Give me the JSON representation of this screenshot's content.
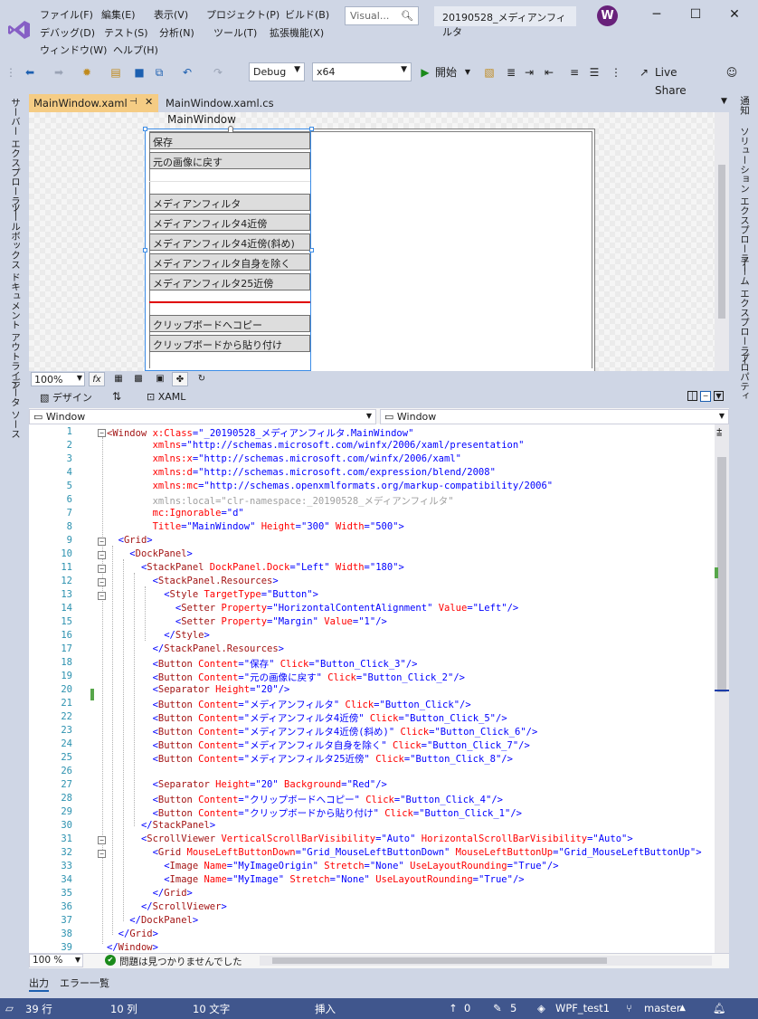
{
  "menu": {
    "row1": [
      "ファイル(F)",
      "編集(E)",
      "表示(V)",
      "プロジェクト(P)",
      "ビルド(B)"
    ],
    "row2": [
      "デバッグ(D)",
      "テスト(S)",
      "分析(N)",
      "ツール(T)",
      "拡張機能(X)"
    ],
    "row3": [
      "ウィンドウ(W)",
      "ヘルプ(H)"
    ],
    "search_placeholder": "Visual...",
    "project_title": "20190528_メディアンフィルタ",
    "avatar_letter": "W"
  },
  "toolbar": {
    "config": "Debug",
    "platform": "x64",
    "start": "開始",
    "liveshare": "Live Share"
  },
  "left_panels": [
    "サーバー エクスプローラー",
    "ツールボックス",
    "ドキュメント アウトライン",
    "データ ソース"
  ],
  "right_panels": [
    "通知",
    "ソリューション エクスプローラー",
    "チーム エクスプローラー",
    "プロパティ"
  ],
  "tabs": [
    {
      "label": "MainWindow.xaml",
      "active": true
    },
    {
      "label": "MainWindow.xaml.cs",
      "active": false
    }
  ],
  "design": {
    "window_title": "MainWindow",
    "buttons_top": [
      "保存",
      "元の画像に戻す"
    ],
    "buttons_mid": [
      "メディアンフィルタ",
      "メディアンフィルタ4近傍",
      "メディアンフィルタ4近傍(斜め)",
      "メディアンフィルタ自身を除く",
      "メディアンフィルタ25近傍"
    ],
    "buttons_bottom": [
      "クリップボードへコピー",
      "クリップボードから貼り付け"
    ],
    "zoom": "100%"
  },
  "split": {
    "design_tab": "デザイン",
    "xaml_tab": "XAML"
  },
  "element_combos": {
    "left": "Window",
    "right": "Window"
  },
  "code_lines": [
    [
      [
        "tg",
        "<"
      ],
      [
        "tg",
        "Window"
      ],
      [
        "at",
        " x:Class"
      ],
      [
        "br",
        "=\""
      ],
      [
        "vl",
        "_20190528_メディアンフィルタ.MainWindow"
      ],
      [
        "br",
        "\""
      ]
    ],
    [
      [
        "pad",
        "        "
      ],
      [
        "at",
        "xmlns"
      ],
      [
        "br",
        "=\""
      ],
      [
        "vl",
        "http://schemas.microsoft.com/winfx/2006/xaml/presentation"
      ],
      [
        "br",
        "\""
      ]
    ],
    [
      [
        "pad",
        "        "
      ],
      [
        "at",
        "xmlns:x"
      ],
      [
        "br",
        "=\""
      ],
      [
        "vl",
        "http://schemas.microsoft.com/winfx/2006/xaml"
      ],
      [
        "br",
        "\""
      ]
    ],
    [
      [
        "pad",
        "        "
      ],
      [
        "at",
        "xmlns:d"
      ],
      [
        "br",
        "=\""
      ],
      [
        "vl",
        "http://schemas.microsoft.com/expression/blend/2008"
      ],
      [
        "br",
        "\""
      ]
    ],
    [
      [
        "pad",
        "        "
      ],
      [
        "at",
        "xmlns:mc"
      ],
      [
        "br",
        "=\""
      ],
      [
        "vl",
        "http://schemas.openxmlformats.org/markup-compatibility/2006"
      ],
      [
        "br",
        "\""
      ]
    ],
    [
      [
        "pad",
        "        "
      ],
      [
        "gr",
        "xmlns:local=\"clr-namespace:_20190528_メディアンフィルタ\""
      ]
    ],
    [
      [
        "pad",
        "        "
      ],
      [
        "at",
        "mc:Ignorable"
      ],
      [
        "br",
        "=\""
      ],
      [
        "vl",
        "d"
      ],
      [
        "br",
        "\""
      ]
    ],
    [
      [
        "pad",
        "        "
      ],
      [
        "at",
        "Title"
      ],
      [
        "br",
        "=\""
      ],
      [
        "vl",
        "MainWindow"
      ],
      [
        "br",
        "\""
      ],
      [
        "at",
        " Height"
      ],
      [
        "br",
        "=\""
      ],
      [
        "vl",
        "300"
      ],
      [
        "br",
        "\""
      ],
      [
        "at",
        " Width"
      ],
      [
        "br",
        "=\""
      ],
      [
        "vl",
        "500"
      ],
      [
        "br",
        "\">"
      ]
    ],
    [
      [
        "pad",
        "  "
      ],
      [
        "br",
        "<"
      ],
      [
        "tg",
        "Grid"
      ],
      [
        "br",
        ">"
      ]
    ],
    [
      [
        "pad",
        "    "
      ],
      [
        "br",
        "<"
      ],
      [
        "tg",
        "DockPanel"
      ],
      [
        "br",
        ">"
      ]
    ],
    [
      [
        "pad",
        "      "
      ],
      [
        "br",
        "<"
      ],
      [
        "tg",
        "StackPanel"
      ],
      [
        "at",
        " DockPanel.Dock"
      ],
      [
        "br",
        "=\""
      ],
      [
        "vl",
        "Left"
      ],
      [
        "br",
        "\""
      ],
      [
        "at",
        " Width"
      ],
      [
        "br",
        "=\""
      ],
      [
        "vl",
        "180"
      ],
      [
        "br",
        "\">"
      ]
    ],
    [
      [
        "pad",
        "        "
      ],
      [
        "br",
        "<"
      ],
      [
        "tg",
        "StackPanel.Resources"
      ],
      [
        "br",
        ">"
      ]
    ],
    [
      [
        "pad",
        "          "
      ],
      [
        "br",
        "<"
      ],
      [
        "tg",
        "Style"
      ],
      [
        "at",
        " TargetType"
      ],
      [
        "br",
        "=\""
      ],
      [
        "vl",
        "Button"
      ],
      [
        "br",
        "\">"
      ]
    ],
    [
      [
        "pad",
        "            "
      ],
      [
        "br",
        "<"
      ],
      [
        "tg",
        "Setter"
      ],
      [
        "at",
        " Property"
      ],
      [
        "br",
        "=\""
      ],
      [
        "vl",
        "HorizontalContentAlignment"
      ],
      [
        "br",
        "\""
      ],
      [
        "at",
        " Value"
      ],
      [
        "br",
        "=\""
      ],
      [
        "vl",
        "Left"
      ],
      [
        "br",
        "\"/>"
      ]
    ],
    [
      [
        "pad",
        "            "
      ],
      [
        "br",
        "<"
      ],
      [
        "tg",
        "Setter"
      ],
      [
        "at",
        " Property"
      ],
      [
        "br",
        "=\""
      ],
      [
        "vl",
        "Margin"
      ],
      [
        "br",
        "\""
      ],
      [
        "at",
        " Value"
      ],
      [
        "br",
        "=\""
      ],
      [
        "vl",
        "1"
      ],
      [
        "br",
        "\"/>"
      ]
    ],
    [
      [
        "pad",
        "          "
      ],
      [
        "br",
        "</"
      ],
      [
        "tg",
        "Style"
      ],
      [
        "br",
        ">"
      ]
    ],
    [
      [
        "pad",
        "        "
      ],
      [
        "br",
        "</"
      ],
      [
        "tg",
        "StackPanel.Resources"
      ],
      [
        "br",
        ">"
      ]
    ],
    [
      [
        "pad",
        "        "
      ],
      [
        "br",
        "<"
      ],
      [
        "tg",
        "Button"
      ],
      [
        "at",
        " Content"
      ],
      [
        "br",
        "=\""
      ],
      [
        "vl",
        "保存"
      ],
      [
        "br",
        "\""
      ],
      [
        "at",
        " Click"
      ],
      [
        "br",
        "=\""
      ],
      [
        "vl",
        "Button_Click_3"
      ],
      [
        "br",
        "\"/>"
      ]
    ],
    [
      [
        "pad",
        "        "
      ],
      [
        "br",
        "<"
      ],
      [
        "tg",
        "Button"
      ],
      [
        "at",
        " Content"
      ],
      [
        "br",
        "=\""
      ],
      [
        "vl",
        "元の画像に戻す"
      ],
      [
        "br",
        "\""
      ],
      [
        "at",
        " Click"
      ],
      [
        "br",
        "=\""
      ],
      [
        "vl",
        "Button_Click_2"
      ],
      [
        "br",
        "\"/>"
      ]
    ],
    [
      [
        "pad",
        "        "
      ],
      [
        "br",
        "<"
      ],
      [
        "tg",
        "Separator"
      ],
      [
        "at",
        " Height"
      ],
      [
        "br",
        "=\""
      ],
      [
        "vl",
        "20"
      ],
      [
        "br",
        "\"/>"
      ]
    ],
    [
      [
        "pad",
        "        "
      ],
      [
        "br",
        "<"
      ],
      [
        "tg",
        "Button"
      ],
      [
        "at",
        " Content"
      ],
      [
        "br",
        "=\""
      ],
      [
        "vl",
        "メディアンフィルタ"
      ],
      [
        "br",
        "\""
      ],
      [
        "at",
        " Click"
      ],
      [
        "br",
        "=\""
      ],
      [
        "vl",
        "Button_Click"
      ],
      [
        "br",
        "\"/>"
      ]
    ],
    [
      [
        "pad",
        "        "
      ],
      [
        "br",
        "<"
      ],
      [
        "tg",
        "Button"
      ],
      [
        "at",
        " Content"
      ],
      [
        "br",
        "=\""
      ],
      [
        "vl",
        "メディアンフィルタ4近傍"
      ],
      [
        "br",
        "\""
      ],
      [
        "at",
        " Click"
      ],
      [
        "br",
        "=\""
      ],
      [
        "vl",
        "Button_Click_5"
      ],
      [
        "br",
        "\"/>"
      ]
    ],
    [
      [
        "pad",
        "        "
      ],
      [
        "br",
        "<"
      ],
      [
        "tg",
        "Button"
      ],
      [
        "at",
        " Content"
      ],
      [
        "br",
        "=\""
      ],
      [
        "vl",
        "メディアンフィルタ4近傍(斜め)"
      ],
      [
        "br",
        "\""
      ],
      [
        "at",
        " Click"
      ],
      [
        "br",
        "=\""
      ],
      [
        "vl",
        "Button_Click_6"
      ],
      [
        "br",
        "\"/>"
      ]
    ],
    [
      [
        "pad",
        "        "
      ],
      [
        "br",
        "<"
      ],
      [
        "tg",
        "Button"
      ],
      [
        "at",
        " Content"
      ],
      [
        "br",
        "=\""
      ],
      [
        "vl",
        "メディアンフィルタ自身を除く"
      ],
      [
        "br",
        "\""
      ],
      [
        "at",
        " Click"
      ],
      [
        "br",
        "=\""
      ],
      [
        "vl",
        "Button_Click_7"
      ],
      [
        "br",
        "\"/>"
      ]
    ],
    [
      [
        "pad",
        "        "
      ],
      [
        "br",
        "<"
      ],
      [
        "tg",
        "Button"
      ],
      [
        "at",
        " Content"
      ],
      [
        "br",
        "=\""
      ],
      [
        "vl",
        "メディアンフィルタ25近傍"
      ],
      [
        "br",
        "\""
      ],
      [
        "at",
        " Click"
      ],
      [
        "br",
        "=\""
      ],
      [
        "vl",
        "Button_Click_8"
      ],
      [
        "br",
        "\"/>"
      ]
    ],
    [],
    [
      [
        "pad",
        "        "
      ],
      [
        "br",
        "<"
      ],
      [
        "tg",
        "Separator"
      ],
      [
        "at",
        " Height"
      ],
      [
        "br",
        "=\""
      ],
      [
        "vl",
        "20"
      ],
      [
        "br",
        "\""
      ],
      [
        "at",
        " Background"
      ],
      [
        "br",
        "=\""
      ],
      [
        "vl",
        "Red"
      ],
      [
        "br",
        "\"/>"
      ]
    ],
    [
      [
        "pad",
        "        "
      ],
      [
        "br",
        "<"
      ],
      [
        "tg",
        "Button"
      ],
      [
        "at",
        " Content"
      ],
      [
        "br",
        "=\""
      ],
      [
        "vl",
        "クリップボードへコピー"
      ],
      [
        "br",
        "\""
      ],
      [
        "at",
        " Click"
      ],
      [
        "br",
        "=\""
      ],
      [
        "vl",
        "Button_Click_4"
      ],
      [
        "br",
        "\"/>"
      ]
    ],
    [
      [
        "pad",
        "        "
      ],
      [
        "br",
        "<"
      ],
      [
        "tg",
        "Button"
      ],
      [
        "at",
        " Content"
      ],
      [
        "br",
        "=\""
      ],
      [
        "vl",
        "クリップボードから貼り付け"
      ],
      [
        "br",
        "\""
      ],
      [
        "at",
        " Click"
      ],
      [
        "br",
        "=\""
      ],
      [
        "vl",
        "Button_Click_1"
      ],
      [
        "br",
        "\"/>"
      ]
    ],
    [
      [
        "pad",
        "      "
      ],
      [
        "br",
        "</"
      ],
      [
        "tg",
        "StackPanel"
      ],
      [
        "br",
        ">"
      ]
    ],
    [
      [
        "pad",
        "      "
      ],
      [
        "br",
        "<"
      ],
      [
        "tg",
        "ScrollViewer"
      ],
      [
        "at",
        " VerticalScrollBarVisibility"
      ],
      [
        "br",
        "=\""
      ],
      [
        "vl",
        "Auto"
      ],
      [
        "br",
        "\""
      ],
      [
        "at",
        " HorizontalScrollBarVisibility"
      ],
      [
        "br",
        "=\""
      ],
      [
        "vl",
        "Auto"
      ],
      [
        "br",
        "\">"
      ]
    ],
    [
      [
        "pad",
        "        "
      ],
      [
        "br",
        "<"
      ],
      [
        "tg",
        "Grid"
      ],
      [
        "at",
        " MouseLeftButtonDown"
      ],
      [
        "br",
        "=\""
      ],
      [
        "vl",
        "Grid_MouseLeftButtonDown"
      ],
      [
        "br",
        "\""
      ],
      [
        "at",
        " MouseLeftButtonUp"
      ],
      [
        "br",
        "=\""
      ],
      [
        "vl",
        "Grid_MouseLeftButtonUp"
      ],
      [
        "br",
        "\">"
      ]
    ],
    [
      [
        "pad",
        "          "
      ],
      [
        "br",
        "<"
      ],
      [
        "tg",
        "Image"
      ],
      [
        "at",
        " Name"
      ],
      [
        "br",
        "=\""
      ],
      [
        "vl",
        "MyImageOrigin"
      ],
      [
        "br",
        "\""
      ],
      [
        "at",
        " Stretch"
      ],
      [
        "br",
        "=\""
      ],
      [
        "vl",
        "None"
      ],
      [
        "br",
        "\""
      ],
      [
        "at",
        " UseLayoutRounding"
      ],
      [
        "br",
        "=\""
      ],
      [
        "vl",
        "True"
      ],
      [
        "br",
        "\"/>"
      ]
    ],
    [
      [
        "pad",
        "          "
      ],
      [
        "br",
        "<"
      ],
      [
        "tg",
        "Image"
      ],
      [
        "at",
        " Name"
      ],
      [
        "br",
        "=\""
      ],
      [
        "vl",
        "MyImage"
      ],
      [
        "br",
        "\""
      ],
      [
        "at",
        " Stretch"
      ],
      [
        "br",
        "=\""
      ],
      [
        "vl",
        "None"
      ],
      [
        "br",
        "\""
      ],
      [
        "at",
        " UseLayoutRounding"
      ],
      [
        "br",
        "=\""
      ],
      [
        "vl",
        "True"
      ],
      [
        "br",
        "\"/>"
      ]
    ],
    [
      [
        "pad",
        "        "
      ],
      [
        "br",
        "</"
      ],
      [
        "tg",
        "Grid"
      ],
      [
        "br",
        ">"
      ]
    ],
    [
      [
        "pad",
        "      "
      ],
      [
        "br",
        "</"
      ],
      [
        "tg",
        "ScrollViewer"
      ],
      [
        "br",
        ">"
      ]
    ],
    [
      [
        "pad",
        "    "
      ],
      [
        "br",
        "</"
      ],
      [
        "tg",
        "DockPanel"
      ],
      [
        "br",
        ">"
      ]
    ],
    [
      [
        "pad",
        "  "
      ],
      [
        "br",
        "</"
      ],
      [
        "tg",
        "Grid"
      ],
      [
        "br",
        ">"
      ]
    ],
    [
      [
        "br",
        "</"
      ],
      [
        "tg",
        "Window"
      ],
      [
        "br",
        ">"
      ]
    ]
  ],
  "editor_bottom": {
    "zoom": "100 %",
    "issues": "問題は見つかりませんでした"
  },
  "output_tabs": [
    "出力",
    "エラー一覧"
  ],
  "status": {
    "line": "39 行",
    "col": "10 列",
    "chars": "10 文字",
    "mode": "挿入",
    "up": "0",
    "edits": "5",
    "project": "WPF_test1",
    "branch": "master"
  },
  "colors": {
    "chrome": "#cfd6e5",
    "tab_active": "#f5cc84",
    "statusbar": "#40568d",
    "vs_purple": "#68217a"
  }
}
